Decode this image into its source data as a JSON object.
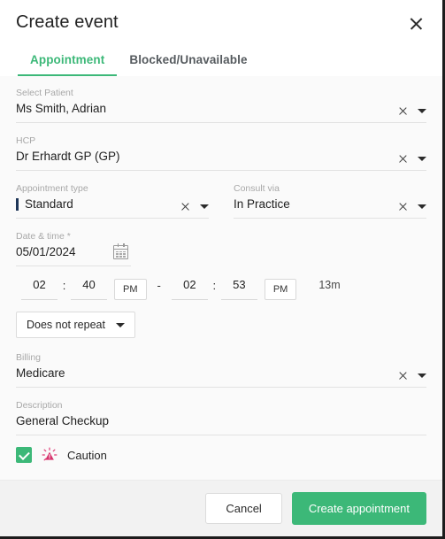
{
  "header": {
    "title": "Create event",
    "close_icon": "close-icon",
    "tabs": [
      {
        "label": "Appointment",
        "active": true
      },
      {
        "label": "Blocked/Unavailable",
        "active": false
      }
    ]
  },
  "form": {
    "patient": {
      "label": "Select Patient",
      "value": "Ms Smith, Adrian"
    },
    "hcp": {
      "label": "HCP",
      "value": "Dr Erhardt GP (GP)"
    },
    "appointment_type": {
      "label": "Appointment type",
      "value": "Standard",
      "color": "#1d3557"
    },
    "consult_via": {
      "label": "Consult via",
      "value": "In Practice"
    },
    "date": {
      "label": "Date & time *",
      "value": "05/01/2024",
      "icon": "calendar-icon"
    },
    "time": {
      "start_hour": "02",
      "start_minute": "40",
      "start_meridiem": "PM",
      "separator": "-",
      "end_hour": "02",
      "end_minute": "53",
      "end_meridiem": "PM",
      "colon": ":",
      "duration": "13m"
    },
    "repeat": {
      "value": "Does not repeat"
    },
    "billing": {
      "label": "Billing",
      "value": "Medicare"
    },
    "description": {
      "label": "Description",
      "value": "General Checkup"
    },
    "caution": {
      "label": "Caution",
      "checked": true,
      "icon": "caution-icon",
      "icon_color": "#e0407a"
    }
  },
  "footer": {
    "cancel_label": "Cancel",
    "submit_label": "Create appointment"
  },
  "colors": {
    "accent": "#3cb878",
    "body_bg": "#fafafa",
    "footer_bg": "#f2f2f2"
  }
}
